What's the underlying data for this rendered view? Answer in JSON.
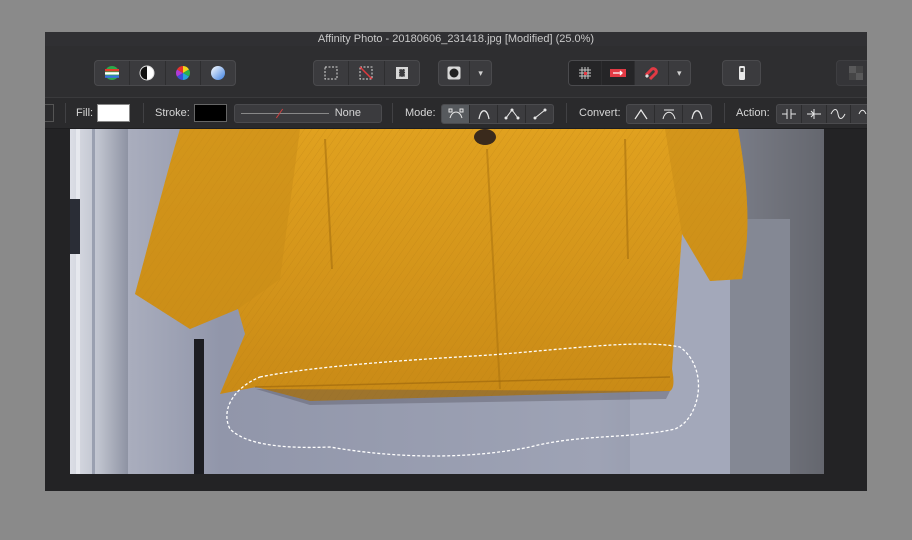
{
  "window": {
    "title": "Affinity Photo - 20180606_231418.jpg [Modified] (25.0%)"
  },
  "toolbar": {
    "persona_icons": [
      "color-wheel-stripes-icon",
      "half-circle-icon",
      "color-wheel-icon",
      "gradient-sphere-icon"
    ],
    "selection_icons": [
      "marquee-select-icon",
      "deselect-icon",
      "invert-selection-icon"
    ],
    "quick_mask_icon": "quick-mask-icon",
    "snapping_icons": [
      "grid-icon",
      "force-pixel-alignment-icon",
      "snapping-magnet-icon"
    ],
    "export_icon": "export-icon",
    "dropdown_glyph": "▾"
  },
  "context": {
    "fill_label": "Fill:",
    "fill_color": "#ffffff",
    "stroke_label": "Stroke:",
    "stroke_color": "#000000",
    "stroke_style_value": "None",
    "mode_label": "Mode:",
    "convert_label": "Convert:",
    "action_label": "Action:",
    "mode_icons": [
      "pen-mode-icon",
      "smart-mode-icon",
      "polygon-mode-icon",
      "line-mode-icon"
    ],
    "convert_icons": [
      "sharp-corner-icon",
      "smooth-node-icon",
      "smart-node-icon"
    ],
    "action_icons": [
      "break-curve-icon",
      "close-curve-icon",
      "smooth-curve-icon"
    ]
  },
  "colors": {
    "coat": "#d99a1c",
    "selection_outline": "#ffffff"
  }
}
